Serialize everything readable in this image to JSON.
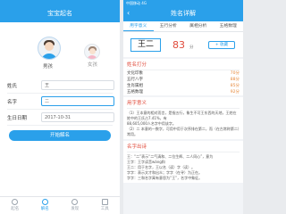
{
  "left": {
    "title": "宝宝起名",
    "gender": {
      "boy": "男孩",
      "girl": "女孩"
    },
    "form": {
      "surname_label": "姓氏",
      "surname_value": "王",
      "name_label": "名字",
      "name_value": "二",
      "birth_label": "生日日期",
      "birth_value": "2017-10-31"
    },
    "submit": "开始解名",
    "tabs": [
      "起名",
      "解名",
      "发现",
      "工具"
    ]
  },
  "right": {
    "status_left": "中国移动 4G",
    "title": "姓名详解",
    "back": "‹",
    "tabs": [
      "用字意义",
      "五行分析",
      "属相分析",
      "五格数理"
    ],
    "name": "王二",
    "score": "83",
    "score_unit": "分",
    "collect": "+ 收藏",
    "scores_title": "姓名打分",
    "scores": [
      {
        "label": "文化印象",
        "value": "70分"
      },
      {
        "label": "五行八字",
        "value": "88分"
      },
      {
        "label": "生肖属相",
        "value": "85分"
      },
      {
        "label": "五格数理",
        "value": "92分"
      }
    ],
    "meaning_title": "用字意义",
    "meaning_lines": [
      "（1）王本意的相对而言，是指五行，象生不可王东西的天地，王姓在姓中的王氏占7.41%，有",
      "88,605,000人名字中用该字。",
      "（2）二 本意的一数字，可用中用于次序排在第二，而（在古常称第二）常用。"
    ],
    "poem_title": "名字出诗",
    "poem_lines": [
      "王：“二”表示“二气清和、二位生辉、二人同心”，意为",
      "王字：王字读音wáng和",
      "王二：用于名字，王以名（读）字（读）。",
      "字字：表示文才和出众；字字（在寻）为正在。",
      "字字：三和名字寓有意思为“王”，名字中象征。"
    ]
  }
}
